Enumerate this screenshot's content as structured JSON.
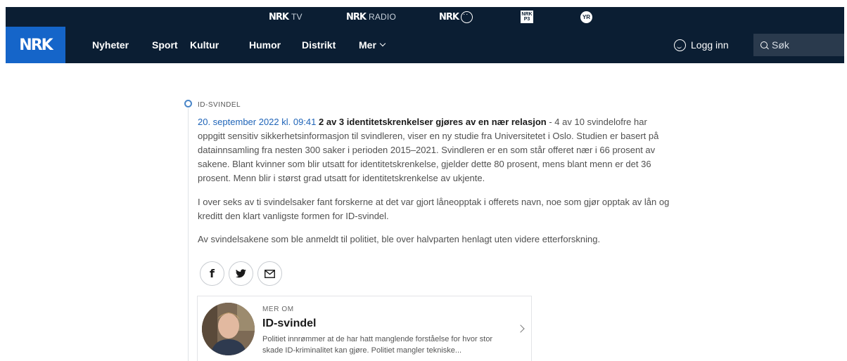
{
  "services": {
    "tv": {
      "logo": "NRK",
      "label": "TV"
    },
    "radio": {
      "logo": "NRK",
      "label": "RADIO"
    },
    "super": {
      "logo": "NRK"
    },
    "p3": {
      "logo": "NRK P3"
    },
    "yr": {
      "logo": "YR"
    }
  },
  "nav": {
    "logo": "NRK",
    "items": [
      "Nyheter",
      "Sport",
      "Kultur",
      "Humor",
      "Distrikt",
      "Mer"
    ],
    "login": "Logg inn",
    "search_placeholder": "Søk"
  },
  "article": {
    "topic": "ID-SVINDEL",
    "timestamp": "20. september 2022 kl. 09:41",
    "headline": "2 av 3 identitetskrenkelser gjøres av en nær relasjon",
    "lead": " - 4 av 10 svindelofre har oppgitt sensitiv sikkerhetsinformasjon til svindleren, viser en ny studie fra Universitetet i Oslo. Studien er basert på datainnsamling fra nesten 300 saker i perioden 2015–2021. Svindleren er en som står offeret nær i 66 prosent av sakene. Blant kvinner som blir utsatt for identitetskrenkelse, gjelder dette 80 prosent, mens blant menn er det 36 prosent. Menn blir i størst grad utsatt for identitetskrenkelse av ukjente.",
    "paragraph2": "I over seks av ti svindelsaker fant forskerne at det var gjort låneopptak i offerets navn, noe som gjør opptak av lån og kreditt den klart vanligste formen for ID-svindel.",
    "paragraph3": "Av svindelsakene som ble anmeldt til politiet, ble over halvparten henlagt uten videre etterforskning."
  },
  "share": {
    "facebook": "f",
    "twitter": "twitter-icon",
    "email": "email-icon"
  },
  "related": {
    "kicker": "MER OM",
    "title": "ID-svindel",
    "description": "Politiet innrømmer at de har hatt manglende forståelse for hvor stor skade ID-kriminalitet kan gjøre. Politiet mangler tekniske..."
  },
  "colors": {
    "topbar": "#0b1e33",
    "logo_bg": "#1565c9",
    "link": "#1f64b8"
  }
}
